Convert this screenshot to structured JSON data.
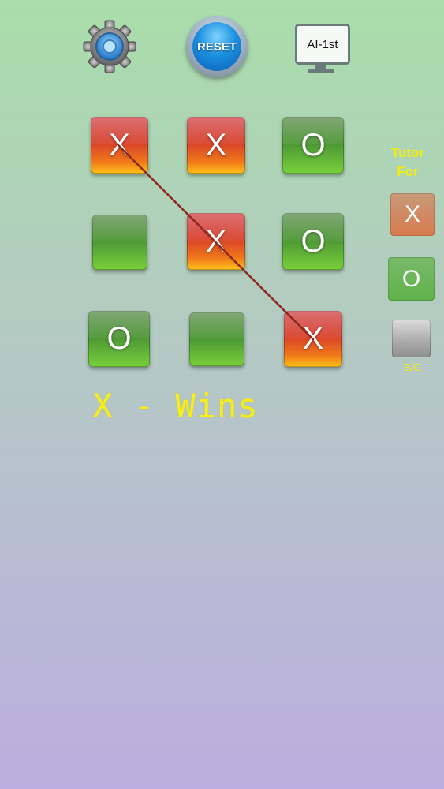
{
  "toolbar": {
    "settings_icon": "gear-icon",
    "reset_label": "RESET",
    "mode_label": "AI-1st"
  },
  "board": {
    "cells": [
      "X",
      "X",
      "O",
      "",
      "X",
      "O",
      "O",
      "",
      "X"
    ],
    "winning_line": [
      0,
      4,
      8
    ]
  },
  "status": {
    "text": "X - Wins"
  },
  "tutor": {
    "label_line1": "Tutor",
    "label_line2": "For",
    "x_label": "X",
    "o_label": "O",
    "bg_label": "B/G"
  },
  "colors": {
    "x_tile": "#d8402a",
    "o_tile": "#4f9a35",
    "status_text": "#f6ee1c",
    "win_line": "#8c2a22"
  }
}
